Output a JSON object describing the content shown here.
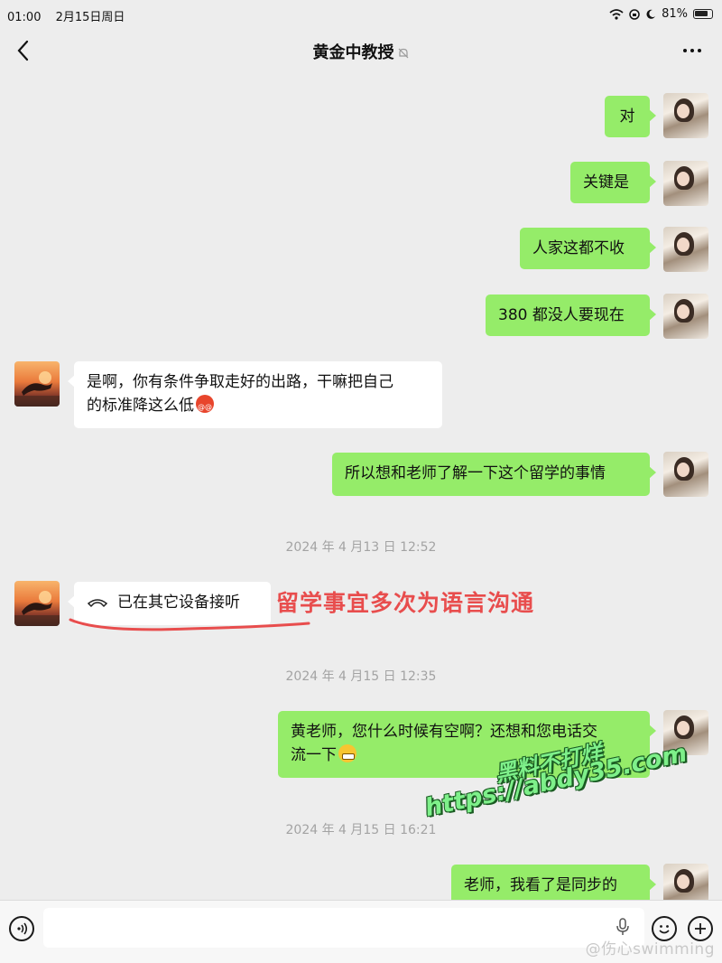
{
  "status_bar": {
    "time": "01:00",
    "date": "2月15日周日",
    "battery": "81%"
  },
  "header": {
    "title": "黄金中教授"
  },
  "messages": [
    {
      "from": "me",
      "text": "对"
    },
    {
      "from": "me",
      "text": "关键是"
    },
    {
      "from": "me",
      "text": "人家这都不收"
    },
    {
      "from": "me",
      "text": "380 都没人要现在"
    },
    {
      "from": "them",
      "line1": "是啊，你有条件争取走好的出路，干嘛把自己",
      "line2": "的标准降这么低"
    },
    {
      "from": "me",
      "text": "所以想和老师了解一下这个留学的事情"
    },
    {
      "from": "them",
      "text": "已在其它设备接听"
    },
    {
      "from": "me",
      "line1": "黄老师，您什么时候有空啊？还想和您电话交",
      "line2": "流一下"
    },
    {
      "from": "me",
      "text": "老师，我看了是同步的"
    }
  ],
  "timestamps": [
    "2024 年 4 月13 日 12:52",
    "2024 年 4 月15 日 12:35",
    "2024 年 4 月15 日 16:21"
  ],
  "annotation": {
    "text": "留学事宜多次为语言沟通",
    "color": "#e84d4d"
  },
  "watermark": {
    "line1": "黑料不打烊",
    "line2": "https://abdy35.com",
    "weibo": "@伤心swimming"
  },
  "colors": {
    "my_bubble": "#95ec69",
    "their_bubble": "#ffffff",
    "background": "#ededed"
  },
  "icons": {
    "back": "chevron-left-icon",
    "mute": "bell-off-icon",
    "more": "more-dots-icon",
    "call": "phone-hangup-icon",
    "voice": "voice-icon",
    "emoji": "emoji-icon",
    "plus": "plus-icon"
  }
}
